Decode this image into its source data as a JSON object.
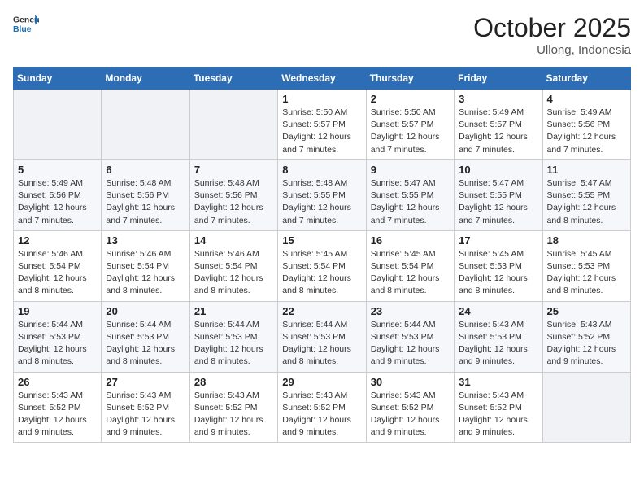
{
  "logo": {
    "text_general": "General",
    "text_blue": "Blue"
  },
  "title": "October 2025",
  "location": "Ullong, Indonesia",
  "weekdays": [
    "Sunday",
    "Monday",
    "Tuesday",
    "Wednesday",
    "Thursday",
    "Friday",
    "Saturday"
  ],
  "weeks": [
    [
      {
        "day": "",
        "info": ""
      },
      {
        "day": "",
        "info": ""
      },
      {
        "day": "",
        "info": ""
      },
      {
        "day": "1",
        "info": "Sunrise: 5:50 AM\nSunset: 5:57 PM\nDaylight: 12 hours and 7 minutes."
      },
      {
        "day": "2",
        "info": "Sunrise: 5:50 AM\nSunset: 5:57 PM\nDaylight: 12 hours and 7 minutes."
      },
      {
        "day": "3",
        "info": "Sunrise: 5:49 AM\nSunset: 5:57 PM\nDaylight: 12 hours and 7 minutes."
      },
      {
        "day": "4",
        "info": "Sunrise: 5:49 AM\nSunset: 5:56 PM\nDaylight: 12 hours and 7 minutes."
      }
    ],
    [
      {
        "day": "5",
        "info": "Sunrise: 5:49 AM\nSunset: 5:56 PM\nDaylight: 12 hours and 7 minutes."
      },
      {
        "day": "6",
        "info": "Sunrise: 5:48 AM\nSunset: 5:56 PM\nDaylight: 12 hours and 7 minutes."
      },
      {
        "day": "7",
        "info": "Sunrise: 5:48 AM\nSunset: 5:56 PM\nDaylight: 12 hours and 7 minutes."
      },
      {
        "day": "8",
        "info": "Sunrise: 5:48 AM\nSunset: 5:55 PM\nDaylight: 12 hours and 7 minutes."
      },
      {
        "day": "9",
        "info": "Sunrise: 5:47 AM\nSunset: 5:55 PM\nDaylight: 12 hours and 7 minutes."
      },
      {
        "day": "10",
        "info": "Sunrise: 5:47 AM\nSunset: 5:55 PM\nDaylight: 12 hours and 7 minutes."
      },
      {
        "day": "11",
        "info": "Sunrise: 5:47 AM\nSunset: 5:55 PM\nDaylight: 12 hours and 8 minutes."
      }
    ],
    [
      {
        "day": "12",
        "info": "Sunrise: 5:46 AM\nSunset: 5:54 PM\nDaylight: 12 hours and 8 minutes."
      },
      {
        "day": "13",
        "info": "Sunrise: 5:46 AM\nSunset: 5:54 PM\nDaylight: 12 hours and 8 minutes."
      },
      {
        "day": "14",
        "info": "Sunrise: 5:46 AM\nSunset: 5:54 PM\nDaylight: 12 hours and 8 minutes."
      },
      {
        "day": "15",
        "info": "Sunrise: 5:45 AM\nSunset: 5:54 PM\nDaylight: 12 hours and 8 minutes."
      },
      {
        "day": "16",
        "info": "Sunrise: 5:45 AM\nSunset: 5:54 PM\nDaylight: 12 hours and 8 minutes."
      },
      {
        "day": "17",
        "info": "Sunrise: 5:45 AM\nSunset: 5:53 PM\nDaylight: 12 hours and 8 minutes."
      },
      {
        "day": "18",
        "info": "Sunrise: 5:45 AM\nSunset: 5:53 PM\nDaylight: 12 hours and 8 minutes."
      }
    ],
    [
      {
        "day": "19",
        "info": "Sunrise: 5:44 AM\nSunset: 5:53 PM\nDaylight: 12 hours and 8 minutes."
      },
      {
        "day": "20",
        "info": "Sunrise: 5:44 AM\nSunset: 5:53 PM\nDaylight: 12 hours and 8 minutes."
      },
      {
        "day": "21",
        "info": "Sunrise: 5:44 AM\nSunset: 5:53 PM\nDaylight: 12 hours and 8 minutes."
      },
      {
        "day": "22",
        "info": "Sunrise: 5:44 AM\nSunset: 5:53 PM\nDaylight: 12 hours and 8 minutes."
      },
      {
        "day": "23",
        "info": "Sunrise: 5:44 AM\nSunset: 5:53 PM\nDaylight: 12 hours and 9 minutes."
      },
      {
        "day": "24",
        "info": "Sunrise: 5:43 AM\nSunset: 5:53 PM\nDaylight: 12 hours and 9 minutes."
      },
      {
        "day": "25",
        "info": "Sunrise: 5:43 AM\nSunset: 5:52 PM\nDaylight: 12 hours and 9 minutes."
      }
    ],
    [
      {
        "day": "26",
        "info": "Sunrise: 5:43 AM\nSunset: 5:52 PM\nDaylight: 12 hours and 9 minutes."
      },
      {
        "day": "27",
        "info": "Sunrise: 5:43 AM\nSunset: 5:52 PM\nDaylight: 12 hours and 9 minutes."
      },
      {
        "day": "28",
        "info": "Sunrise: 5:43 AM\nSunset: 5:52 PM\nDaylight: 12 hours and 9 minutes."
      },
      {
        "day": "29",
        "info": "Sunrise: 5:43 AM\nSunset: 5:52 PM\nDaylight: 12 hours and 9 minutes."
      },
      {
        "day": "30",
        "info": "Sunrise: 5:43 AM\nSunset: 5:52 PM\nDaylight: 12 hours and 9 minutes."
      },
      {
        "day": "31",
        "info": "Sunrise: 5:43 AM\nSunset: 5:52 PM\nDaylight: 12 hours and 9 minutes."
      },
      {
        "day": "",
        "info": ""
      }
    ]
  ]
}
